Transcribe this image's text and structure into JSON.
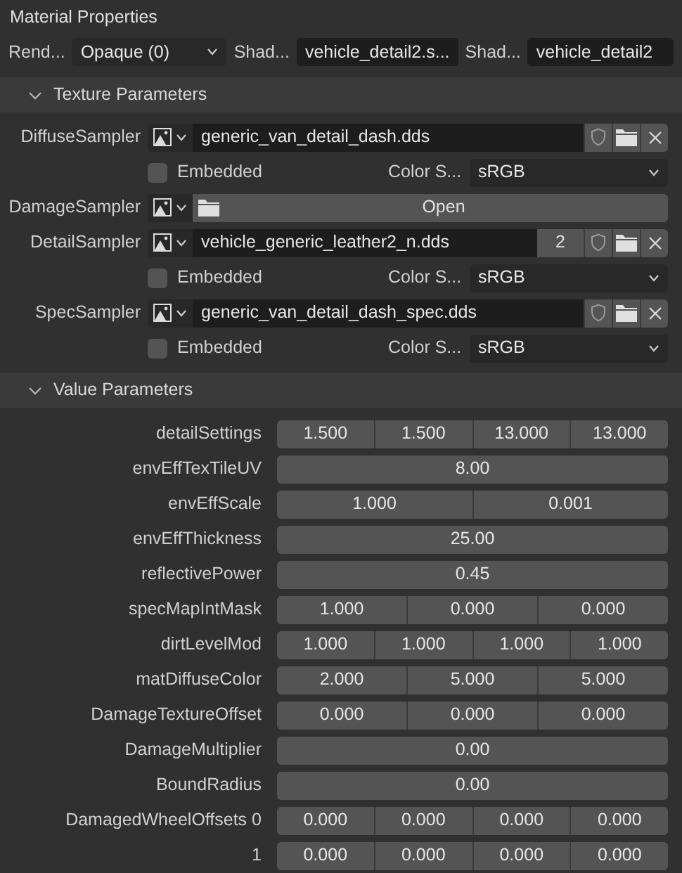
{
  "title": "Material Properties",
  "header_fields": [
    {
      "kind": "dropdown",
      "label": "Rend...",
      "value": "Opaque (0)"
    },
    {
      "kind": "text",
      "label": "Shad...",
      "value": "vehicle_detail2.s..."
    },
    {
      "kind": "text",
      "label": "Shad...",
      "value": "vehicle_detail2"
    }
  ],
  "texture_section": {
    "title": "Texture Parameters",
    "expanded": true,
    "samplers": [
      {
        "kind": "file",
        "label": "DiffuseSampler",
        "file": "generic_van_detail_dash.dds",
        "embedded": false,
        "embedded_label": "Embedded",
        "color_space_label": "Color S...",
        "color_space": "sRGB"
      },
      {
        "kind": "open",
        "label": "DamageSampler",
        "button": "Open"
      },
      {
        "kind": "file",
        "label": "DetailSampler",
        "file": "vehicle_generic_leather2_n.dds",
        "users": "2",
        "embedded": false,
        "embedded_label": "Embedded",
        "color_space_label": "Color S...",
        "color_space": "sRGB"
      },
      {
        "kind": "file",
        "label": "SpecSampler",
        "file": "generic_van_detail_dash_spec.dds",
        "embedded": false,
        "embedded_label": "Embedded",
        "color_space_label": "Color S...",
        "color_space": "sRGB"
      }
    ]
  },
  "value_section": {
    "title": "Value Parameters",
    "expanded": true,
    "rows": [
      {
        "label": "detailSettings",
        "values": [
          "1.500",
          "1.500",
          "13.000",
          "13.000"
        ]
      },
      {
        "label": "envEffTexTileUV",
        "values": [
          "8.00"
        ]
      },
      {
        "label": "envEffScale",
        "values": [
          "1.000",
          "0.001"
        ]
      },
      {
        "label": "envEffThickness",
        "values": [
          "25.00"
        ]
      },
      {
        "label": "reflectivePower",
        "values": [
          "0.45"
        ]
      },
      {
        "label": "specMapIntMask",
        "values": [
          "1.000",
          "0.000",
          "0.000"
        ]
      },
      {
        "label": "dirtLevelMod",
        "values": [
          "1.000",
          "1.000",
          "1.000",
          "1.000"
        ]
      },
      {
        "label": "matDiffuseColor",
        "values": [
          "2.000",
          "5.000",
          "5.000"
        ]
      },
      {
        "label": "DamageTextureOffset",
        "values": [
          "0.000",
          "0.000",
          "0.000"
        ]
      },
      {
        "label": "DamageMultiplier",
        "values": [
          "0.00"
        ]
      },
      {
        "label": "BoundRadius",
        "values": [
          "0.00"
        ]
      },
      {
        "label": "DamagedWheelOffsets 0",
        "values": [
          "0.000",
          "0.000",
          "0.000",
          "0.000"
        ]
      },
      {
        "label": "1",
        "values": [
          "0.000",
          "0.000",
          "0.000",
          "0.000"
        ]
      }
    ]
  }
}
